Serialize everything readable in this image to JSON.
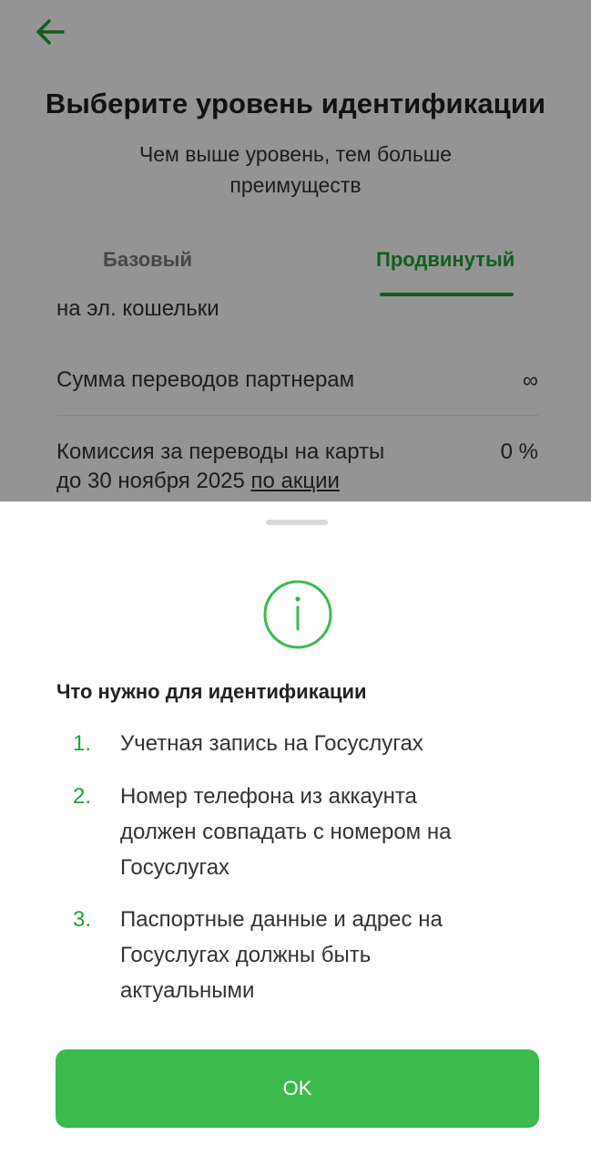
{
  "header": {
    "back_icon": "arrow-left-icon",
    "title": "Выберите уровень идентификации",
    "subtitle": "Чем выше уровень, тем больше преимуществ"
  },
  "tabs": [
    {
      "label": "Базовый",
      "selected": false
    },
    {
      "label": "Продвинутый",
      "selected": true
    }
  ],
  "limits": {
    "partial_row": "на эл. кошельки",
    "rows": [
      {
        "label": "Сумма переводов партнерам",
        "value": "∞"
      },
      {
        "label_line1": "Комиссия за переводы на карты",
        "label_line2_prefix": "до 30 ноября 2025",
        "link": "по акции",
        "value": "0 %"
      }
    ]
  },
  "sheet": {
    "icon": "info-icon",
    "heading": "Что нужно для идентификации",
    "steps": [
      {
        "num": "1.",
        "text": "Учетная запись на Госуслугах"
      },
      {
        "num": "2.",
        "text": "Номер телефона из аккаунта должен совпадать с номером на Госуслугах"
      },
      {
        "num": "3.",
        "text": "Паспортные данные и адрес на Госуслугах должны быть актуальными"
      }
    ],
    "ok_label": "OK"
  },
  "colors": {
    "accent": "#21a038",
    "button": "#3dba4e",
    "overlay": "rgba(0,0,0,0.42)"
  }
}
